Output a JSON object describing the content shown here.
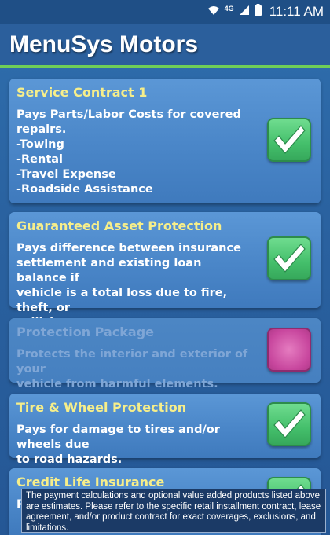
{
  "status_bar": {
    "network": "4G",
    "time": "11:11 AM"
  },
  "header": {
    "title": "MenuSys Motors"
  },
  "colors": {
    "accent_green": "#6fcf57",
    "title_yellow": "#f6ee8a",
    "check_green": "#44bf6b",
    "unselected_magenta": "#c8479e"
  },
  "products": [
    {
      "title": "Service Contract 1",
      "description": "Pays Parts/Labor Costs for covered\nrepairs.\n-Towing\n-Rental\n-Travel Expense\n-Roadside Assistance",
      "selected": true
    },
    {
      "title": "Guaranteed Asset Protection",
      "description": "Pays difference between insurance\nsettlement and existing loan balance if\nvehicle is a total loss due to fire, theft, or\ncollision.",
      "selected": true
    },
    {
      "title": "Protection Package",
      "description": "Protects the interior and exterior of your\nvehicle from harmful elements.",
      "selected": false
    },
    {
      "title": "Tire & Wheel Protection",
      "description": "Pays for damage to tires and/or wheels due\nto road hazards.",
      "selected": true
    },
    {
      "title": "Credit Life Insurance",
      "description": "P",
      "selected": true
    }
  ],
  "disclaimer": "The payment calculations and optional value added products listed above are estimates. Please refer to the specific retail installment contract, lease agreement, and/or product contract for exact coverages, exclusions, and limitations."
}
